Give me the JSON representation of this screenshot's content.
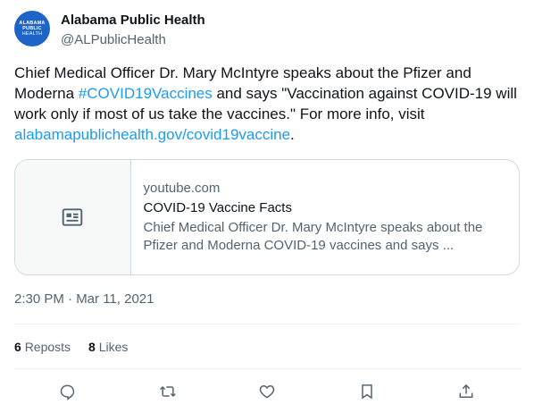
{
  "account": {
    "avatar_lines": [
      "ALABAMA",
      "PUBLIC",
      "HEALTH"
    ],
    "name": "Alabama Public Health",
    "handle": "@ALPublicHealth"
  },
  "tweet": {
    "text_1": "Chief Medical Officer Dr. Mary McIntyre speaks about the Pfizer and Moderna ",
    "hashtag": "#COVID19Vaccines",
    "text_2": " and says \"Vaccination against COVID-19 will work only if most of us take the vaccines.\" For more info, visit ",
    "url": "alabamapublichealth.gov/covid19vaccine",
    "text_3": "."
  },
  "card": {
    "domain": "youtube.com",
    "title": "COVID-19 Vaccine Facts",
    "description": "Chief Medical Officer Dr. Mary McIntyre speaks about the Pfizer and Moderna COVID-19 vaccines and says ..."
  },
  "timestamp": "2:30 PM · Mar 11, 2021",
  "stats": {
    "reposts_count": "6",
    "reposts_label": "Reposts",
    "likes_count": "8",
    "likes_label": "Likes"
  },
  "actions": [
    "reply-icon",
    "repost-icon",
    "like-icon",
    "bookmark-icon",
    "share-icon"
  ],
  "colors": {
    "link": "#1d9bf0",
    "text": "#0f1419",
    "secondary": "#536471",
    "avatar": "#1e64c8"
  }
}
